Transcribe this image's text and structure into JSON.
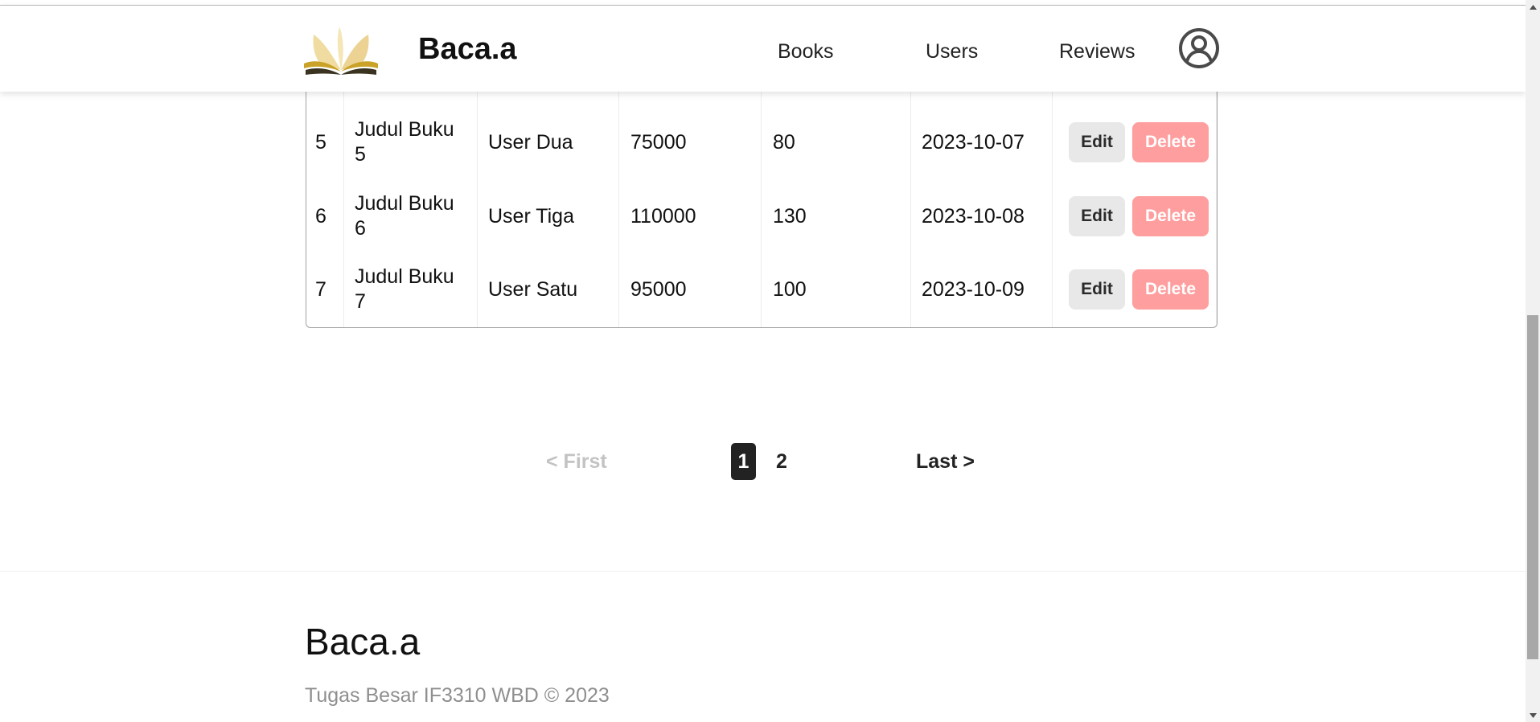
{
  "header": {
    "brand": "Baca.a",
    "nav": [
      "Books",
      "Users",
      "Reviews"
    ]
  },
  "table": {
    "rows": [
      {
        "id": "5",
        "title_line1": "Judul Buku",
        "title_line2": "5",
        "user": "User Dua",
        "price": "75000",
        "pages": "80",
        "date": "2023-10-07"
      },
      {
        "id": "6",
        "title_line1": "Judul Buku",
        "title_line2": "6",
        "user": "User Tiga",
        "price": "110000",
        "pages": "130",
        "date": "2023-10-08"
      },
      {
        "id": "7",
        "title_line1": "Judul Buku",
        "title_line2": "7",
        "user": "User Satu",
        "price": "95000",
        "pages": "100",
        "date": "2023-10-09"
      }
    ],
    "edit_label": "Edit",
    "delete_label": "Delete"
  },
  "pagination": {
    "first": "< First",
    "pages": [
      "1",
      "2"
    ],
    "active_page": "1",
    "last": "Last >"
  },
  "footer": {
    "brand": "Baca.a",
    "copyright": "Tugas Besar IF3310 WBD © 2023"
  },
  "colors": {
    "delete_bg": "#ff9e9e",
    "edit_bg": "#e8e8e8",
    "active_page_bg": "#222222",
    "logo_gold": "#c9a227",
    "logo_cream": "#f0dca0"
  },
  "icons": {
    "logo": "open-book-icon",
    "profile": "user-circle-icon"
  }
}
